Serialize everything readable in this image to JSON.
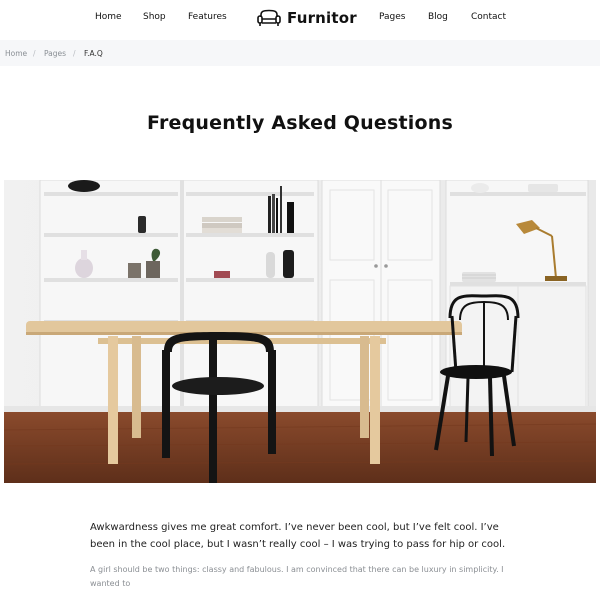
{
  "header": {
    "nav_left": [
      "Home",
      "Shop",
      "Features"
    ],
    "brand": "Furnitor",
    "nav_right": [
      "Pages",
      "Blog",
      "Contact"
    ]
  },
  "breadcrumb": {
    "items": [
      "Home",
      "Pages",
      "F.A.Q"
    ],
    "separator": "/"
  },
  "page": {
    "title": "Frequently Asked Questions"
  },
  "content": {
    "lead": "Awkwardness gives me great comfort. I’ve never been cool, but I’ve felt cool. I’ve been in the cool place, but I wasn’t really cool – I was trying to pass for hip or cool.",
    "body": "A girl should be two things: classy and fabulous. I am convinced that there can be luxury in simplicity. I wanted to"
  },
  "icons": {
    "brand_logo": "armchair-icon"
  },
  "colors": {
    "text": "#111111",
    "breadcrumb_bg": "#f6f7f9",
    "muted": "#8b8f94"
  }
}
